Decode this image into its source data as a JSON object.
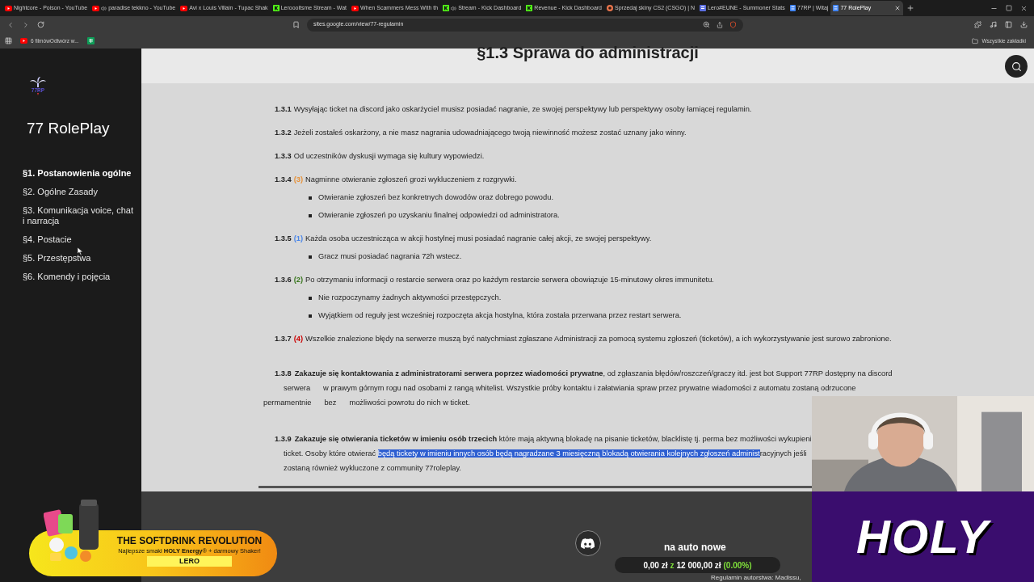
{
  "browser": {
    "tabs": [
      {
        "title": "Nightcore - Poison - YouTube",
        "kind": "video",
        "audio": false,
        "selected": false
      },
      {
        "title": "paradise tekkno - YouTube",
        "kind": "video",
        "audio": true,
        "selected": false
      },
      {
        "title": "Avi x Louis Villain - Tupac Shak",
        "kind": "video",
        "audio": false,
        "selected": false
      },
      {
        "title": "Leroooitsme Stream - Wat",
        "kind": "stream",
        "audio": false,
        "selected": false
      },
      {
        "title": "When Scammers Mess With th",
        "kind": "video",
        "audio": false,
        "selected": false
      },
      {
        "title": "Stream - Kick Dashboard",
        "kind": "stream",
        "audio": true,
        "selected": false
      },
      {
        "title": "Revenue - Kick Dashboard",
        "kind": "stream",
        "audio": false,
        "selected": false
      },
      {
        "title": "Sprzedaj skiny CS2 (CSGO) | N",
        "kind": "shop",
        "audio": false,
        "selected": false
      },
      {
        "title": "Lero#EUNE - Summoner Stats",
        "kind": "stats",
        "audio": false,
        "selected": false
      },
      {
        "title": "77RP | Witaj",
        "kind": "site",
        "audio": false,
        "selected": false
      },
      {
        "title": "77 RolePlay",
        "kind": "site",
        "audio": false,
        "selected": true
      }
    ],
    "url": "sites.google.com/view/77-regulamin",
    "bookmarks": [
      {
        "title": "6 filmówOdtwórz w...",
        "kind": "video"
      },
      {
        "kind": "sheet"
      }
    ],
    "bookmarks_folder": "Wszystkie zakładki"
  },
  "sidebar": {
    "logo_text": "77RP",
    "site_title": "77 RolePlay",
    "items": [
      {
        "label": "§1. Postanowienia ogólne",
        "selected": true
      },
      {
        "label": "§2. Ogólne Zasady",
        "selected": false
      },
      {
        "label": "§3. Komunikacja voice, chat i narracja",
        "selected": false
      },
      {
        "label": "§4. Postacie",
        "selected": false
      },
      {
        "label": "§5. Przestępstwa",
        "selected": false
      },
      {
        "label": "§6. Komendy i pojęcia",
        "selected": false
      }
    ]
  },
  "content": {
    "heading": "§1.3 Sprawa do administracji",
    "rules": [
      {
        "kind": "simple",
        "number": "1.3.1",
        "text": "Wysyłając ticket na discord jako oskarżyciel musisz posiadać nagranie, ze swojej perspektywy lub perspektywy osoby łamiącej regulamin."
      },
      {
        "kind": "simple",
        "number": "1.3.2",
        "text": "Jeżeli zostałeś oskarżony, a nie masz nagrania udowadniającego twoją niewinność możesz zostać uznany jako winny."
      },
      {
        "kind": "simple",
        "number": "1.3.3",
        "text": "Od uczestników dyskusji wymaga się kultury wypowiedzi."
      },
      {
        "kind": "simple",
        "number": "1.3.4",
        "badge": {
          "text": "(3)",
          "color": "#e69138"
        },
        "text": "Nagminne otwieranie zgłoszeń grozi wykluczeniem z rozgrywki.",
        "bullets": [
          "Otwieranie zgłoszeń bez konkretnych dowodów oraz dobrego powodu.",
          "Otwieranie zgłoszeń po uzyskaniu finalnej odpowiedzi od administratora."
        ]
      },
      {
        "kind": "simple",
        "number": "1.3.5",
        "badge": {
          "text": "(1)",
          "color": "#4a86e8"
        },
        "text": "Każda osoba uczestnicząca w akcji hostylnej musi posiadać nagranie całej akcji, ze swojej perspektywy.",
        "bullets": [
          "Gracz musi posiadać nagrania 72h wstecz."
        ]
      },
      {
        "kind": "simple",
        "number": "1.3.6",
        "badge": {
          "text": "(2)",
          "color": "#38761d"
        },
        "text": "Po otrzymaniu informacji o restarcie serwera oraz po każdym restarcie serwera obowiązuje 15-minutowy okres immunitetu.",
        "bullets": [
          "Nie rozpoczynamy żadnych aktywności przestępczych.",
          "Wyjątkiem od reguły jest wcześniej rozpoczęta akcja hostylna, która została przerwana przez restart serwera."
        ]
      },
      {
        "kind": "simple",
        "number": "1.3.7",
        "badge": {
          "text": "(4)",
          "color": "#cc0000"
        },
        "text": "Wszelkie znalezione błędy na serwerze muszą być natychmiast zgłaszane Administracji za pomocą systemu zgłoszeń (ticketów), a ich wykorzystywanie jest surowo zabronione."
      },
      {
        "kind": "long",
        "number": "1.3.8",
        "lines": [
          {
            "kind": "first",
            "pieces": [
              [
                {
                  "kind": "plain",
                  "text": "**Zakazuje się kontaktowania z administratorami serwera poprzez wiadomości prywatne**, od zgłaszania błędów/roszczeń/graczy itd. jest bot Support 77RP dostępny na discord"
                }
              ]
            ]
          },
          {
            "kind": "continued",
            "pieces": [
              [
                {
                  "kind": "plain",
                  "text": "serwera"
                }
              ],
              [
                {
                  "kind": "plain",
                  "text": "w prawym górnym rogu nad osobami z rangą whitelist. Wszystkie próby kontaktu i załatwiania spraw przez prywatne wiadomości z automatu zostaną odrzucone"
                }
              ]
            ]
          },
          {
            "kind": "outdent",
            "pieces": [
              [
                {
                  "kind": "plain",
                  "text": "permamentnie"
                }
              ],
              [
                {
                  "kind": "plain",
                  "text": "bez"
                }
              ],
              [
                {
                  "kind": "plain",
                  "text": "możliwości powrotu do nich w ticket."
                }
              ]
            ]
          }
        ]
      },
      {
        "kind": "long",
        "number": "1.3.9",
        "lines": [
          {
            "kind": "first",
            "pieces": [
              [
                {
                  "kind": "plain",
                  "text": "**Zakazuje się otwierania ticketów w imieniu osób trzecich** które mają aktywną blokadę na pisanie ticketów, blacklistę tj. perma bez możliwości wykupieni"
                }
              ]
            ]
          },
          {
            "kind": "continued",
            "pieces": [
              [
                {
                  "kind": "plain",
                  "text": "ticket. Osoby które otwierać "
                },
                {
                  "kind": "highlight",
                  "text": "będą tickety w imieniu innych osób będą nagradzane 3 miesięczną blokadą otwierania kolejnych zgłoszeń administ"
                },
                {
                  "kind": "plain",
                  "text": "racyjnych jeśli"
                }
              ]
            ]
          },
          {
            "kind": "continued",
            "pieces": [
              [
                {
                  "kind": "plain",
                  "text": "zostaną również wykluczone z community 77roleplay."
                }
              ]
            ]
          }
        ]
      }
    ]
  },
  "stream_overlay": {
    "promo": {
      "headline": "THE SOFTDRINK REVOLUTION",
      "tagline": "Najlepsze smaki **HOLY Energy**® + darmowy Shaker!",
      "code": "LERO"
    },
    "goal": {
      "title": "na auto nowe",
      "current": "0,00 zł",
      "separator": "z",
      "target": "12 000,00 zł",
      "percent": "(0.00%)"
    },
    "credit": "Regulamin autorstwa: Madissu,",
    "sponsor": "HOLY"
  }
}
